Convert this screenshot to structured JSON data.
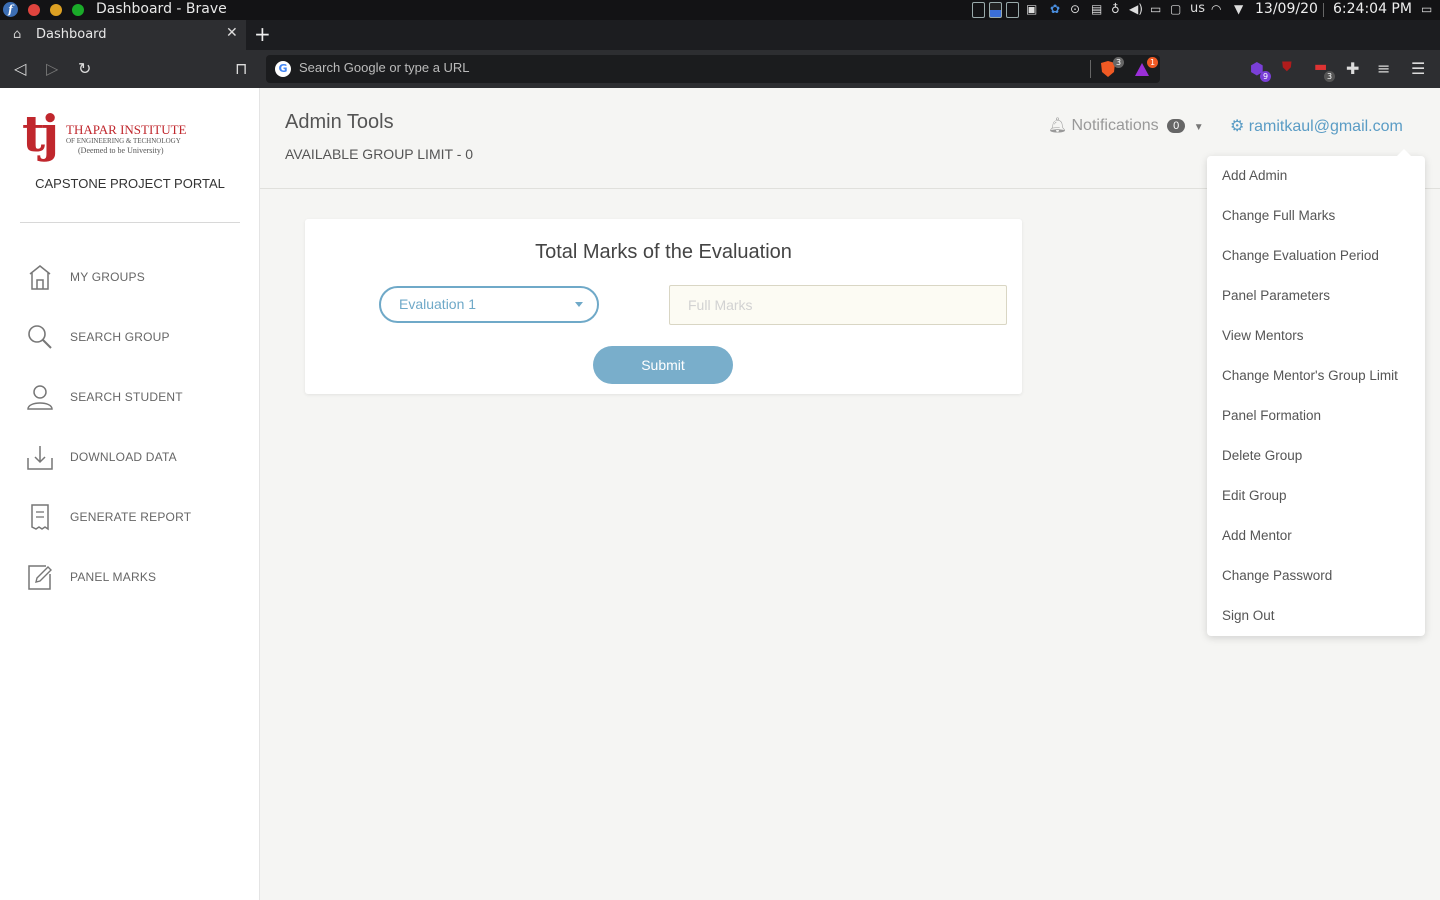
{
  "os": {
    "window_title": "Dashboard - Brave",
    "keyboard_layout": "us",
    "date": "13/09/20",
    "time": "6:24:04 PM"
  },
  "browser": {
    "tab_title": "Dashboard",
    "url_placeholder": "Search Google or type a URL",
    "brave_shield_count": "3",
    "rewards_count": "1",
    "ext_badge_1": "9",
    "ext_badge_2": "3"
  },
  "sidebar": {
    "logo_text_1": "THAPAR INSTITUTE",
    "logo_text_2": "OF ENGINEERING & TECHNOLOGY",
    "logo_text_3": "(Deemed to be University)",
    "portal_title": "CAPSTONE PROJECT PORTAL",
    "items": [
      {
        "label": "MY GROUPS",
        "icon": "home-icon"
      },
      {
        "label": "SEARCH GROUP",
        "icon": "search-icon"
      },
      {
        "label": "SEARCH STUDENT",
        "icon": "user-icon"
      },
      {
        "label": "DOWNLOAD DATA",
        "icon": "download-icon"
      },
      {
        "label": "GENERATE REPORT",
        "icon": "report-icon"
      },
      {
        "label": "PANEL MARKS",
        "icon": "edit-icon"
      }
    ]
  },
  "header": {
    "title": "Admin Tools",
    "group_limit": "AVAILABLE GROUP LIMIT - 0",
    "notifications_label": "Notifications",
    "notifications_count": "0",
    "user_email": "ramitkaul@gmail.com"
  },
  "card": {
    "title": "Total Marks of the Evaluation",
    "select_value": "Evaluation 1",
    "marks_placeholder": "Full Marks",
    "submit_label": "Submit"
  },
  "dropdown": {
    "items": [
      "Add Admin",
      "Change Full Marks",
      "Change Evaluation Period",
      "Panel Parameters",
      "View Mentors",
      "Change Mentor's Group Limit",
      "Panel Formation",
      "Delete Group",
      "Edit Group",
      "Add Mentor",
      "Change Password",
      "Sign Out"
    ]
  },
  "colors": {
    "accent": "#5a9cc5",
    "brand_red": "#c0272d",
    "button": "#79aecb"
  }
}
